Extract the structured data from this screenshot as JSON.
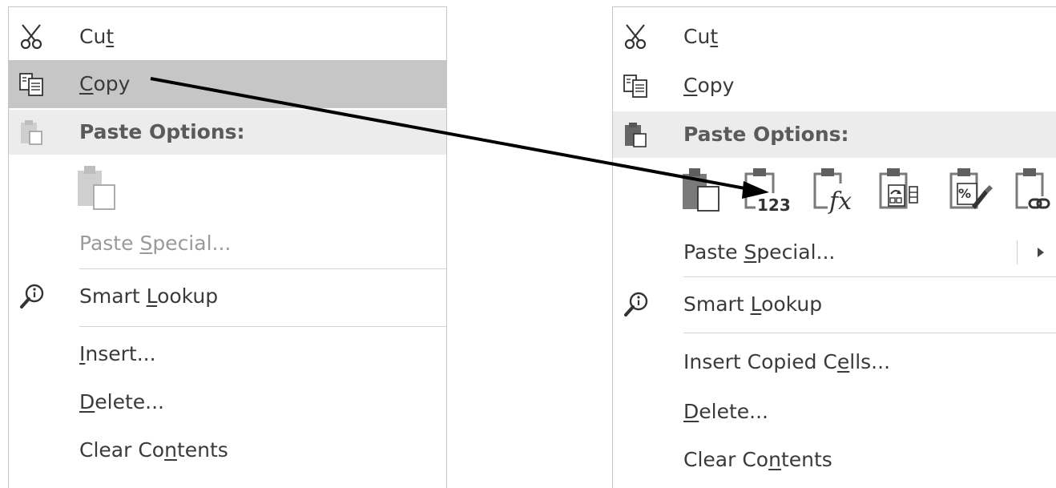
{
  "left_menu": {
    "items": [
      {
        "pre": "Cu",
        "u": "t",
        "post": ""
      },
      {
        "pre": "",
        "u": "C",
        "post": "opy"
      },
      {
        "pre": "Paste Options:",
        "u": "",
        "post": ""
      },
      {
        "pre": "Paste ",
        "u": "S",
        "post": "pecial..."
      },
      {
        "pre": "Smart ",
        "u": "L",
        "post": "ookup"
      },
      {
        "pre": "",
        "u": "I",
        "post": "nsert..."
      },
      {
        "pre": "",
        "u": "D",
        "post": "elete..."
      },
      {
        "pre": "Clear Co",
        "u": "n",
        "post": "tents"
      }
    ]
  },
  "right_menu": {
    "items": [
      {
        "pre": "Cu",
        "u": "t",
        "post": ""
      },
      {
        "pre": "",
        "u": "C",
        "post": "opy"
      },
      {
        "pre": "Paste Options:",
        "u": "",
        "post": ""
      },
      {
        "pre": "Paste ",
        "u": "S",
        "post": "pecial..."
      },
      {
        "pre": "Smart ",
        "u": "L",
        "post": "ookup"
      },
      {
        "pre": "Insert Copied C",
        "u": "e",
        "post": "lls..."
      },
      {
        "pre": "",
        "u": "D",
        "post": "elete..."
      },
      {
        "pre": "Clear Co",
        "u": "n",
        "post": "tents"
      }
    ],
    "paste_values_digits": "123",
    "paste_formulas_glyph": "fx",
    "paste_percent_glyph": "%"
  },
  "icons": [
    "scissors-icon",
    "copy-icon",
    "clipboard-icon",
    "smart-lookup-icon",
    "paste-values-icon",
    "paste-formulas-icon",
    "paste-transpose-icon",
    "paste-formatting-icon",
    "paste-link-icon",
    "submenu-arrow-icon"
  ],
  "colors": {
    "selected_bg": "#c6c6c6",
    "header_bg": "#ececec",
    "arrow": "#000000"
  }
}
